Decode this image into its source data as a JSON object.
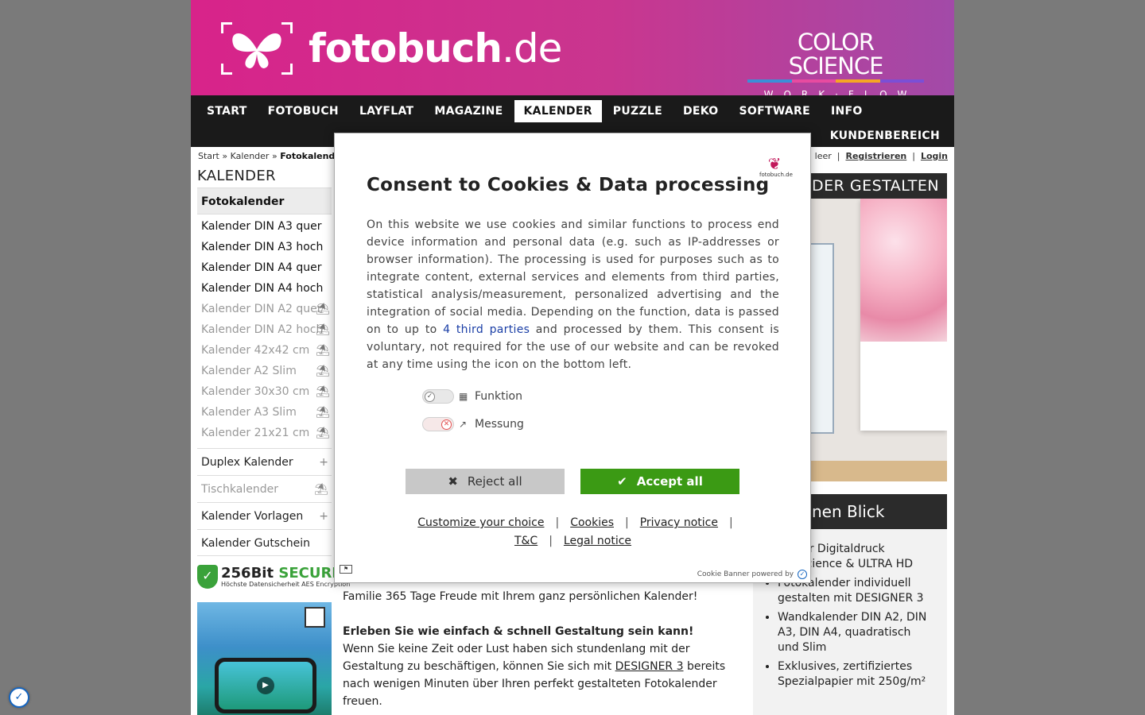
{
  "header": {
    "logo_text": "fotobuch",
    "logo_tld": ".de",
    "partner_title": "COLOR SCIENCE",
    "partner_sub": "WORK·FLOW",
    "partner_colors": [
      "#3a8fd8",
      "#e84ba0",
      "#f5a623",
      "#7b4fd6"
    ]
  },
  "nav": {
    "items": [
      "START",
      "FOTOBUCH",
      "LAYFLAT",
      "MAGAZINE",
      "KALENDER",
      "PUZZLE",
      "DEKO",
      "SOFTWARE",
      "INFO"
    ],
    "active": "KALENDER",
    "account": "KUNDENBEREICH"
  },
  "breadcrumb": {
    "start": "Start",
    "sep": "»",
    "kalender": "Kalender",
    "current": "Fotokalender"
  },
  "userbar": {
    "cart_label": ": leer",
    "register": "Registrieren",
    "login": "Login"
  },
  "sidebar": {
    "title": "KALENDER",
    "head": "Fotokalender",
    "items": [
      {
        "label": "Kalender DIN A3 quer",
        "dim": false
      },
      {
        "label": "Kalender DIN A3 hoch",
        "dim": false
      },
      {
        "label": "Kalender DIN A4 quer",
        "dim": false
      },
      {
        "label": "Kalender DIN A4 hoch",
        "dim": false
      },
      {
        "label": "Kalender DIN A2 quer",
        "dim": true
      },
      {
        "label": "Kalender DIN A2 hoch",
        "dim": true
      },
      {
        "label": "Kalender 42x42 cm",
        "dim": true
      },
      {
        "label": "Kalender A2 Slim",
        "dim": true
      },
      {
        "label": "Kalender 30x30 cm",
        "dim": true
      },
      {
        "label": "Kalender A3 Slim",
        "dim": true
      },
      {
        "label": "Kalender 21x21 cm",
        "dim": true
      }
    ],
    "groups": {
      "duplex": "Duplex Kalender",
      "tisch": "Tischkalender",
      "vorlagen": "Kalender Vorlagen",
      "gutschein": "Kalender Gutschein"
    },
    "secure_big": "256Bit",
    "secure_word": "SECURE",
    "secure_small": "Höchste Datensicherheit AES Encryption"
  },
  "content": {
    "p1": "Familie 365 Tage Freude mit Ihrem ganz persönlichen Kalender!",
    "p2_heading": "Erleben Sie wie einfach & schnell Gestaltung sein kann!",
    "p2_a": "Wenn Sie keine Zeit oder Lust haben sich stundenlang mit der Gestaltung zu beschäftigen, können Sie sich mit ",
    "p2_link": "DESIGNER 3",
    "p2_b": " bereits nach wenigen Minuten über Ihren perfekt gestalteten Fotokalender freuen."
  },
  "rightcol": {
    "banner": "DER GESTALTEN",
    "title": "nen Blick",
    "list": [
      "zierter Digitaldruck olorScience & ULTRA HD",
      "Fotokalender individuell gestalten mit DESIGNER 3",
      "Wandkalender DIN A2, DIN A3, DIN A4, quadratisch und Slim",
      "Exklusives, zertifiziertes Spezialpapier mit 250g/m²"
    ]
  },
  "consent": {
    "logo_text": "fotobuch.de",
    "title": "Consent to Cookies & Data processing",
    "text_a": "On this website we use cookies and similar functions to process end device information and personal data (e.g. such as IP-addresses or browser information). The processing is used for purposes such as to integrate content, external services and elements from third parties, statistical analysis/measurement, personalized advertising and the integration of social media. Depending on the function, data is passed on to up to ",
    "text_link": "4 third parties",
    "text_b": " and processed by them. This consent is voluntary, not required for the use of our website and can be revoked at any time using the icon on the bottom left.",
    "toggle_function": "Funktion",
    "toggle_measure": "Messung",
    "reject": "Reject all",
    "accept": "Accept all",
    "links": {
      "customize": "Customize your choice",
      "cookies": "Cookies",
      "privacy": "Privacy notice",
      "tc": "T&C",
      "legal": "Legal notice"
    },
    "powered": "Cookie Banner powered by"
  }
}
